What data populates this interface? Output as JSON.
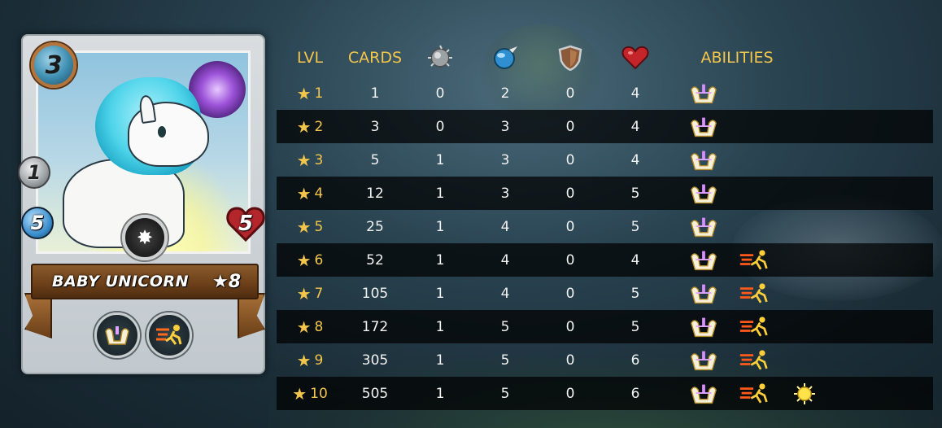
{
  "card": {
    "mana": "3",
    "ranged": "1",
    "speed": "5",
    "health": "5",
    "name": "BABY UNICORN",
    "level": "★8",
    "abilities": [
      "heal-icon",
      "swiftness-icon"
    ]
  },
  "table": {
    "headers": {
      "lvl": "LVL",
      "cards": "CARDS",
      "ranged_icon": "ranged-attack-icon",
      "speed_icon": "speed-icon",
      "armor_icon": "armor-icon",
      "health_icon": "health-icon",
      "abilities": "ABILITIES"
    },
    "rows": [
      {
        "lvl": "1",
        "cards": "1",
        "ranged": "0",
        "speed": "2",
        "armor": "0",
        "health": "4",
        "abilities": [
          "heal-icon"
        ]
      },
      {
        "lvl": "2",
        "cards": "3",
        "ranged": "0",
        "speed": "3",
        "armor": "0",
        "health": "4",
        "abilities": [
          "heal-icon"
        ]
      },
      {
        "lvl": "3",
        "cards": "5",
        "ranged": "1",
        "speed": "3",
        "armor": "0",
        "health": "4",
        "abilities": [
          "heal-icon"
        ]
      },
      {
        "lvl": "4",
        "cards": "12",
        "ranged": "1",
        "speed": "3",
        "armor": "0",
        "health": "5",
        "abilities": [
          "heal-icon"
        ]
      },
      {
        "lvl": "5",
        "cards": "25",
        "ranged": "1",
        "speed": "4",
        "armor": "0",
        "health": "5",
        "abilities": [
          "heal-icon"
        ]
      },
      {
        "lvl": "6",
        "cards": "52",
        "ranged": "1",
        "speed": "4",
        "armor": "0",
        "health": "4",
        "abilities": [
          "heal-icon",
          "swiftness-icon"
        ]
      },
      {
        "lvl": "7",
        "cards": "105",
        "ranged": "1",
        "speed": "4",
        "armor": "0",
        "health": "5",
        "abilities": [
          "heal-icon",
          "swiftness-icon"
        ]
      },
      {
        "lvl": "8",
        "cards": "172",
        "ranged": "1",
        "speed": "5",
        "armor": "0",
        "health": "5",
        "abilities": [
          "heal-icon",
          "swiftness-icon"
        ]
      },
      {
        "lvl": "9",
        "cards": "305",
        "ranged": "1",
        "speed": "5",
        "armor": "0",
        "health": "6",
        "abilities": [
          "heal-icon",
          "swiftness-icon"
        ]
      },
      {
        "lvl": "10",
        "cards": "505",
        "ranged": "1",
        "speed": "5",
        "armor": "0",
        "health": "6",
        "abilities": [
          "heal-icon",
          "swiftness-icon",
          "divine-shield-icon"
        ]
      }
    ]
  },
  "colors": {
    "header_gold": "#f3c64b",
    "row_dark": "#000000",
    "text": "#f2f2f2"
  }
}
